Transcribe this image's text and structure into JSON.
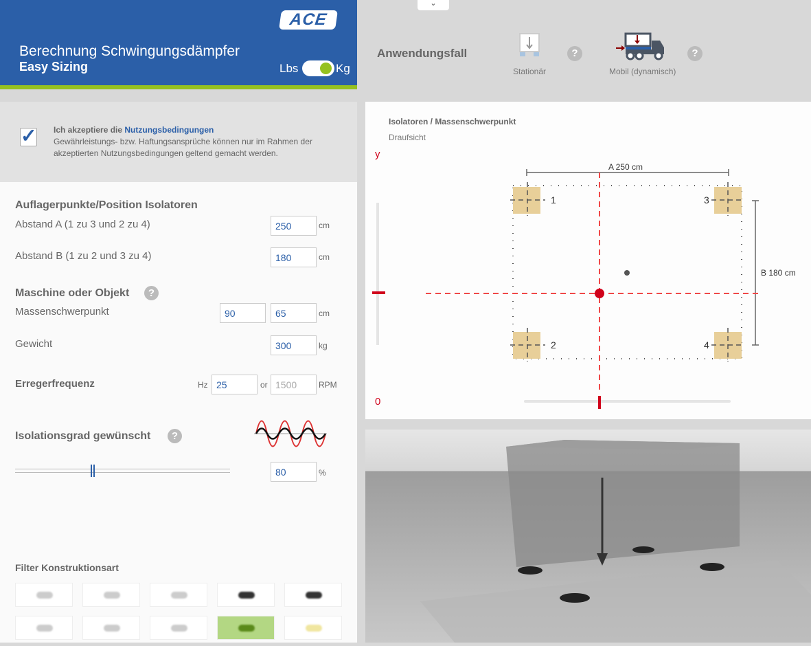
{
  "header": {
    "logo": "ACE",
    "title": "Berechnung Schwingungsdämpfer",
    "subtitle": "Easy Sizing",
    "unit_left": "Lbs",
    "unit_right": "Kg",
    "unit_selected": "Kg"
  },
  "terms": {
    "checked": true,
    "prefix": "Ich akzeptiere die ",
    "link": "Nutzungsbedingungen",
    "text": "Gewährleistungs- bzw. Haftungsansprüche können nur im Rahmen der akzeptierten Nutzungsbedingungen geltend gemacht werden."
  },
  "form": {
    "section1": "Auflagerpunkte/Position Isolatoren",
    "abstand_a": {
      "label": "Abstand A (1 zu 3 und 2 zu 4)",
      "value": "250",
      "unit": "cm"
    },
    "abstand_b": {
      "label": "Abstand B (1 zu 2 und 3 zu 4)",
      "value": "180",
      "unit": "cm"
    },
    "section2": "Maschine oder Objekt",
    "schwerpunkt": {
      "label": "Massenschwerpunkt",
      "x": "90",
      "y": "65",
      "unit": "cm"
    },
    "gewicht": {
      "label": "Gewicht",
      "value": "300",
      "unit": "kg"
    },
    "erreger": {
      "label": "Erregerfrequenz",
      "hz_unit": "Hz",
      "hz_value": "25",
      "or": "or",
      "rpm_placeholder": "1500",
      "rpm_unit": "RPM"
    },
    "isolation": {
      "label": "Isolationsgrad gewünscht",
      "value": "80",
      "unit": "%",
      "slider_percent": 36
    },
    "filter_label": "Filter Konstruktionsart",
    "filter_selected_index": 8,
    "help": "?"
  },
  "top": {
    "label": "Anwendungsfall",
    "options": [
      {
        "label": "Stationär"
      },
      {
        "label": "Mobil (dynamisch)",
        "selected": true
      }
    ],
    "help": "?"
  },
  "diagram": {
    "title": "Isolatoren / Massenschwerpunkt",
    "subtitle": "Draufsicht",
    "y_label": "y",
    "zero_label": "0",
    "dim_a": "A 250 cm",
    "dim_b": "B 180 cm",
    "isolators": [
      "1",
      "2",
      "3",
      "4"
    ]
  },
  "colors": {
    "brand": "#2b5fa8",
    "accent": "#95c11f",
    "red": "#d0021b",
    "iso": "#e8cf99"
  }
}
